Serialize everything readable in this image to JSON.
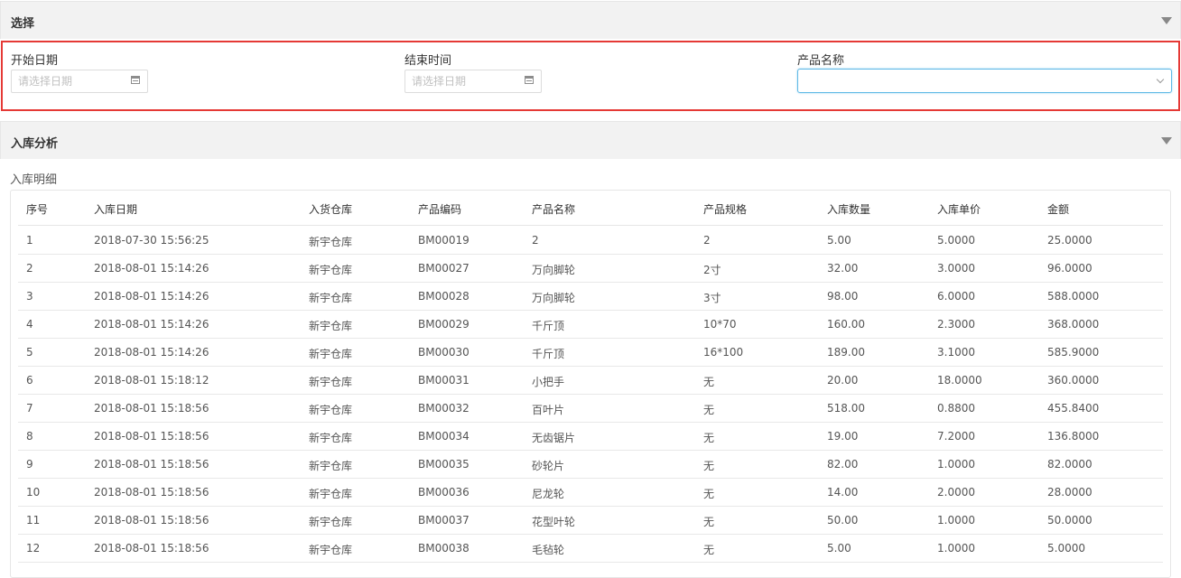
{
  "select_panel": {
    "title": "选择"
  },
  "filters": {
    "start_date": {
      "label": "开始日期",
      "placeholder": "请选择日期"
    },
    "end_time": {
      "label": "结束时间",
      "placeholder": "请选择日期"
    },
    "product_name": {
      "label": "产品名称",
      "value": ""
    }
  },
  "analysis_panel": {
    "title": "入库分析",
    "subtitle": "入库明细"
  },
  "table": {
    "headers": [
      "序号",
      "入库日期",
      "入货仓库",
      "产品编码",
      "产品名称",
      "产品规格",
      "入库数量",
      "入库单价",
      "金额"
    ],
    "rows": [
      [
        "1",
        "2018-07-30 15:56:25",
        "新宇仓库",
        "BM00019",
        "2",
        "2",
        "5.00",
        "5.0000",
        "25.0000"
      ],
      [
        "2",
        "2018-08-01 15:14:26",
        "新宇仓库",
        "BM00027",
        "万向脚轮",
        "2寸",
        "32.00",
        "3.0000",
        "96.0000"
      ],
      [
        "3",
        "2018-08-01 15:14:26",
        "新宇仓库",
        "BM00028",
        "万向脚轮",
        "3寸",
        "98.00",
        "6.0000",
        "588.0000"
      ],
      [
        "4",
        "2018-08-01 15:14:26",
        "新宇仓库",
        "BM00029",
        "千斤顶",
        "10*70",
        "160.00",
        "2.3000",
        "368.0000"
      ],
      [
        "5",
        "2018-08-01 15:14:26",
        "新宇仓库",
        "BM00030",
        "千斤顶",
        "16*100",
        "189.00",
        "3.1000",
        "585.9000"
      ],
      [
        "6",
        "2018-08-01 15:18:12",
        "新宇仓库",
        "BM00031",
        "小把手",
        "无",
        "20.00",
        "18.0000",
        "360.0000"
      ],
      [
        "7",
        "2018-08-01 15:18:56",
        "新宇仓库",
        "BM00032",
        "百叶片",
        "无",
        "518.00",
        "0.8800",
        "455.8400"
      ],
      [
        "8",
        "2018-08-01 15:18:56",
        "新宇仓库",
        "BM00034",
        "无齿锯片",
        "无",
        "19.00",
        "7.2000",
        "136.8000"
      ],
      [
        "9",
        "2018-08-01 15:18:56",
        "新宇仓库",
        "BM00035",
        "砂轮片",
        "无",
        "82.00",
        "1.0000",
        "82.0000"
      ],
      [
        "10",
        "2018-08-01 15:18:56",
        "新宇仓库",
        "BM00036",
        "尼龙轮",
        "无",
        "14.00",
        "2.0000",
        "28.0000"
      ],
      [
        "11",
        "2018-08-01 15:18:56",
        "新宇仓库",
        "BM00037",
        "花型叶轮",
        "无",
        "50.00",
        "1.0000",
        "50.0000"
      ],
      [
        "12",
        "2018-08-01 15:18:56",
        "新宇仓库",
        "BM00038",
        "毛毡轮",
        "无",
        "5.00",
        "1.0000",
        "5.0000"
      ]
    ]
  }
}
